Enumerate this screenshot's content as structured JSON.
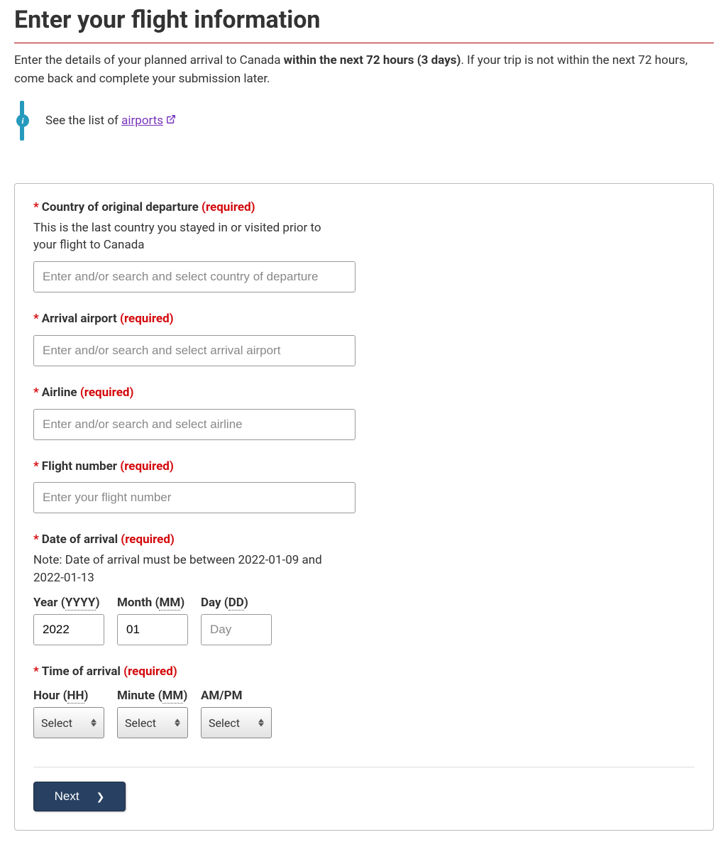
{
  "heading": "Enter your flight information",
  "intro": {
    "prefix": "Enter the details of your planned arrival to Canada ",
    "bold": "within the next 72 hours (3 days)",
    "suffix": ". If your trip is not within the next 72 hours, come back and complete your submission later."
  },
  "info": {
    "icon_char": "i",
    "text": "See the list of ",
    "link_text": "airports"
  },
  "fields": {
    "country": {
      "label": "Country of original departure ",
      "required_text": "(required)",
      "help": "This is the last country you stayed in or visited prior to your flight to Canada",
      "placeholder": "Enter and/or search and select country of departure"
    },
    "airport": {
      "label": "Arrival airport ",
      "required_text": "(required)",
      "placeholder": "Enter and/or search and select arrival airport"
    },
    "airline": {
      "label": "Airline ",
      "required_text": "(required)",
      "placeholder": "Enter and/or search and select airline"
    },
    "flight_number": {
      "label": "Flight number ",
      "required_text": "(required)",
      "placeholder": "Enter your flight number"
    },
    "date": {
      "label": "Date of arrival ",
      "required_text": "(required)",
      "note": "Note: Date of arrival must be between 2022-01-09 and 2022-01-13",
      "year_label_prefix": "Year (",
      "year_abbr": "YYYY",
      "year_label_suffix": ")",
      "month_label_prefix": "Month (",
      "month_abbr": "MM",
      "month_label_suffix": ")",
      "day_label_prefix": "Day (",
      "day_abbr": "DD",
      "day_label_suffix": ")",
      "year_value": "2022",
      "month_value": "01",
      "day_placeholder": "Day"
    },
    "time": {
      "label": "Time of arrival ",
      "required_text": "(required)",
      "hour_label_prefix": "Hour (",
      "hour_abbr": "HH",
      "hour_label_suffix": ")",
      "minute_label_prefix": "Minute (",
      "minute_abbr": "MM",
      "minute_label_suffix": ")",
      "ampm_label": "AM/PM",
      "select_text": "Select"
    }
  },
  "next_button": "Next"
}
